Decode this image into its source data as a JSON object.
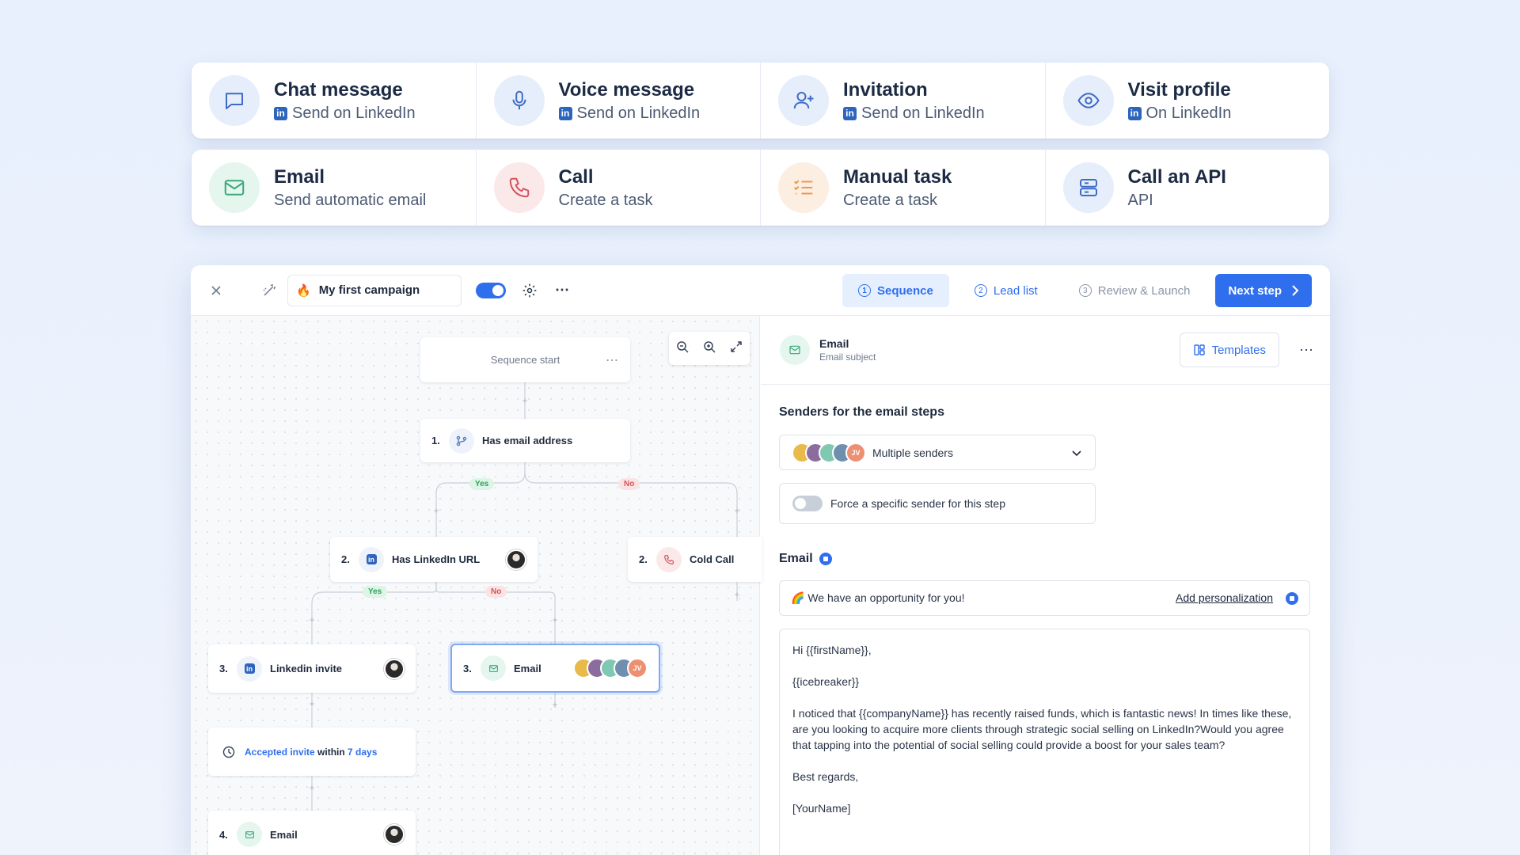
{
  "actions_row1": [
    {
      "title": "Chat message",
      "subtitle": "Send on LinkedIn",
      "icon": "chat-icon"
    },
    {
      "title": "Voice message",
      "subtitle": "Send on LinkedIn",
      "icon": "microphone-icon"
    },
    {
      "title": "Invitation",
      "subtitle": "Send on LinkedIn",
      "icon": "add-user-icon"
    },
    {
      "title": "Visit profile",
      "subtitle": "On LinkedIn",
      "icon": "eye-icon"
    }
  ],
  "actions_row2": [
    {
      "title": "Email",
      "subtitle": "Send automatic email",
      "icon": "mail-icon"
    },
    {
      "title": "Call",
      "subtitle": "Create a task",
      "icon": "phone-icon"
    },
    {
      "title": "Manual task",
      "subtitle": "Create a task",
      "icon": "task-list-icon"
    },
    {
      "title": "Call an API",
      "subtitle": "API",
      "icon": "server-icon"
    }
  ],
  "toolbar": {
    "campaign_name": "My first campaign",
    "campaign_emoji": "🔥",
    "active": true,
    "tabs": [
      {
        "num": "1",
        "label": "Sequence"
      },
      {
        "num": "2",
        "label": "Lead list"
      },
      {
        "num": "3",
        "label": "Review & Launch"
      }
    ],
    "next_label": "Next step"
  },
  "canvas": {
    "start_label": "Sequence start",
    "yes": "Yes",
    "no": "No",
    "nodes": [
      {
        "num": "1.",
        "label": "Has email address",
        "icon": "branch-icon"
      },
      {
        "num": "2.",
        "label": "Has LinkedIn URL",
        "icon": "linkedin-icon"
      },
      {
        "num": "2.",
        "label": "Cold Call",
        "icon": "phone-icon"
      },
      {
        "num": "3.",
        "label": "Linkedin invite",
        "icon": "linkedin-icon"
      },
      {
        "num": "3.",
        "label": "Email",
        "icon": "mail-icon"
      },
      {
        "num": "4.",
        "label": "Email",
        "icon": "mail-icon"
      }
    ],
    "wait": {
      "part1": "Accepted invite",
      "part2": " within ",
      "part3": "7 days"
    },
    "avatar_initials": "JV"
  },
  "panel": {
    "title": "Email",
    "subtitle": "Email subject",
    "templates_label": "Templates",
    "senders_title": "Senders for the email steps",
    "senders_value": "Multiple senders",
    "sender_initials": "JV",
    "force_label": "Force a specific sender for this step",
    "email_title": "Email",
    "subject_value": "🌈 We have an opportunity for you!",
    "add_personalization": "Add personalization",
    "body": [
      "Hi {{firstName}},",
      "{{icebreaker}}",
      "I noticed that {{companyName}} has recently raised funds, which is fantastic news! In times like these, are you looking to acquire more clients through strategic social selling on LinkedIn?Would you agree that tapping into the potential of social selling could provide a boost for your sales team?",
      "Best regards,",
      "[YourName]"
    ]
  },
  "colors": {
    "accent": "#2f6fed",
    "linkedin": "#2d64bc",
    "green": "#3aa77a",
    "red": "#d1545c",
    "orange": "#ea9a4f"
  }
}
